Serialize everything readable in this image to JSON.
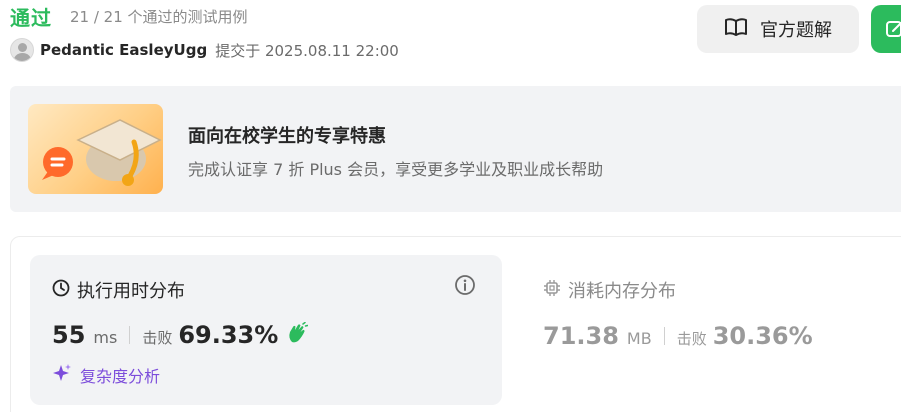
{
  "header": {
    "status": "通过",
    "test_summary": "21 / 21 个通过的测试用例",
    "user_name": "Pedantic EasleyUgg",
    "submitted_text": "提交于 2025.08.11 22:00",
    "solution_button": "官方题解"
  },
  "promo": {
    "title": "面向在校学生的专享特惠",
    "description": "完成认证享 7 折 Plus 会员，享受更多学业及职业成长帮助"
  },
  "runtime": {
    "title": "执行用时分布",
    "value": "55",
    "unit": "ms",
    "beats_label": "击败",
    "beats_pct": "69.33%",
    "complexity_link": "复杂度分析"
  },
  "memory": {
    "title": "消耗内存分布",
    "value": "71.38",
    "unit": "MB",
    "beats_label": "击败",
    "beats_pct": "30.36%"
  },
  "icons": {
    "solution": "book-open-icon",
    "edit": "edit-icon",
    "runtime": "clock-icon",
    "memory": "chip-icon",
    "info": "info-icon",
    "clap": "clap-icon",
    "complexity": "sparkle-icon"
  },
  "colors": {
    "accepted": "#2cbb5d",
    "complexity": "#7c4ddb"
  }
}
